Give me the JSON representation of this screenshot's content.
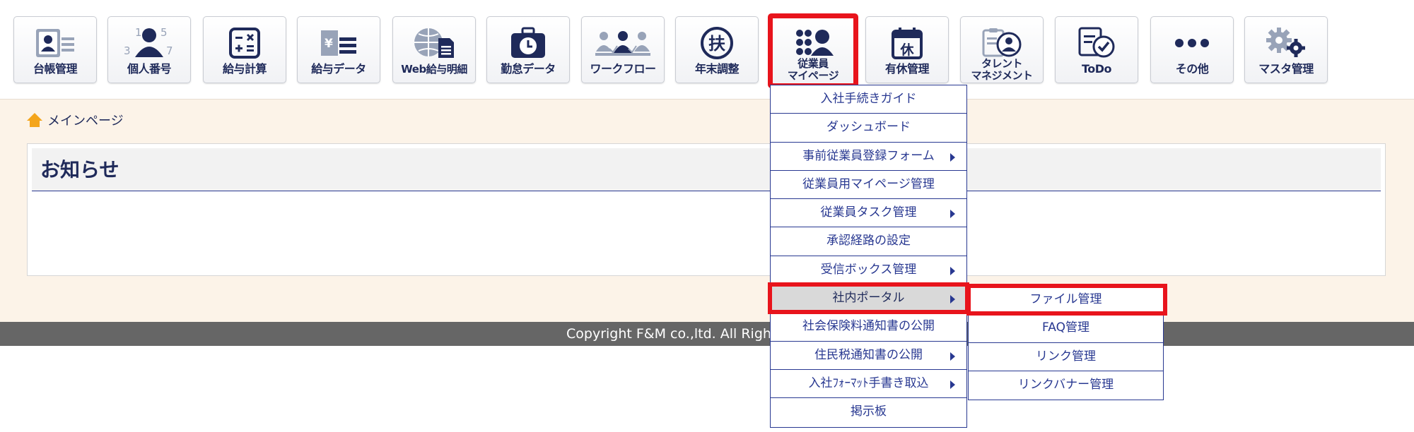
{
  "colors": {
    "brand_navy": "#1f2a5a",
    "menu_blue": "#283891",
    "highlight_red": "#e8141c",
    "main_bg": "#fcf3e8",
    "footer_bg": "#666666"
  },
  "toolbar": [
    {
      "label": "台帳管理",
      "icon": "ledger-icon"
    },
    {
      "label": "個人番号",
      "icon": "my-number-icon"
    },
    {
      "label": "給与計算",
      "icon": "calculator-icon"
    },
    {
      "label": "給与データ",
      "icon": "payroll-data-icon"
    },
    {
      "label": "Web給与明細",
      "icon": "web-payslip-icon"
    },
    {
      "label": "勤怠データ",
      "icon": "attendance-icon"
    },
    {
      "label": "ワークフロー",
      "icon": "workflow-icon"
    },
    {
      "label": "年末調整",
      "icon": "year-end-adjustment-icon"
    },
    {
      "label_line1": "従業員",
      "label_line2": "マイページ",
      "icon": "employee-mypage-icon",
      "active": true
    },
    {
      "label": "有休管理",
      "icon": "paid-leave-icon"
    },
    {
      "label_line1": "タレント",
      "label_line2": "マネジメント",
      "icon": "talent-management-icon"
    },
    {
      "label": "ToDo",
      "icon": "todo-icon"
    },
    {
      "label": "その他",
      "icon": "more-icon"
    },
    {
      "label": "マスタ管理",
      "icon": "master-settings-icon"
    }
  ],
  "breadcrumb": {
    "home_label": "メインページ"
  },
  "notice": {
    "title": "お知らせ"
  },
  "footer": {
    "copyright": "Copyright F&M co.,ltd. All Right"
  },
  "menu": {
    "items": [
      {
        "label": "入社手続きガイド",
        "has_submenu": false
      },
      {
        "label": "ダッシュボード",
        "has_submenu": false
      },
      {
        "label": "事前従業員登録フォーム",
        "has_submenu": true
      },
      {
        "label": "従業員用マイページ管理",
        "has_submenu": false
      },
      {
        "label": "従業員タスク管理",
        "has_submenu": true
      },
      {
        "label": "承認経路の設定",
        "has_submenu": false
      },
      {
        "label": "受信ボックス管理",
        "has_submenu": true
      },
      {
        "label": "社内ポータル",
        "has_submenu": true,
        "active": true
      },
      {
        "label": "社会保険料通知書の公開",
        "has_submenu": false
      },
      {
        "label": "住民税通知書の公開",
        "has_submenu": true
      },
      {
        "label": "入社ﾌｫｰﾏｯﾄ手書き取込",
        "has_submenu": true
      },
      {
        "label": "掲示板",
        "has_submenu": false
      }
    ]
  },
  "submenu": {
    "items": [
      {
        "label": "ファイル管理",
        "active": true
      },
      {
        "label": "FAQ管理"
      },
      {
        "label": "リンク管理"
      },
      {
        "label": "リンクバナー管理"
      }
    ]
  }
}
